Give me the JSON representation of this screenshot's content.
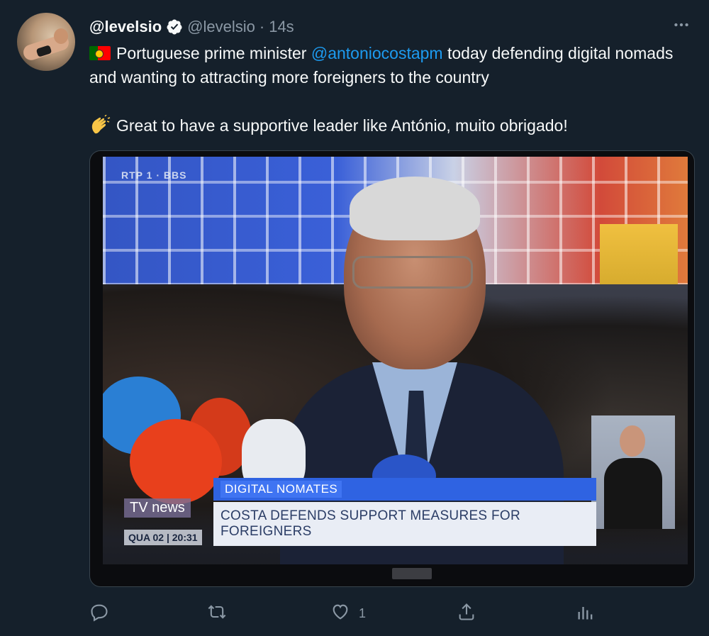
{
  "tweet": {
    "display_name": "@levelsio",
    "handle": "@levelsio",
    "separator": "·",
    "time": "14s",
    "line1_pre": "Portuguese prime minister ",
    "mention": "@antoniocostapm",
    "line1_post": " today defending digital nomads and wanting to attracting more foreigners to the country",
    "line2": "Great to have a supportive leader like António, muito obrigado!",
    "flag_icon": "portugal-flag-icon",
    "clap_icon": "clapping-hands-icon"
  },
  "media": {
    "channel_logo": "RTP 1 · BBS",
    "topic": "DIGITAL NOMATES",
    "headline": "COSTA DEFENDS SUPPORT MEASURES FOR FOREIGNERS",
    "brand": "TV news",
    "clock": "QUA 02 | 20:31"
  },
  "actions": {
    "reply_icon": "reply-icon",
    "retweet_icon": "retweet-icon",
    "like_icon": "heart-icon",
    "like_count": "1",
    "share_icon": "share-icon",
    "analytics_icon": "analytics-icon"
  },
  "colors": {
    "background": "#15202b",
    "accent": "#1d9bf0",
    "secondary_text": "#8b98a5"
  }
}
